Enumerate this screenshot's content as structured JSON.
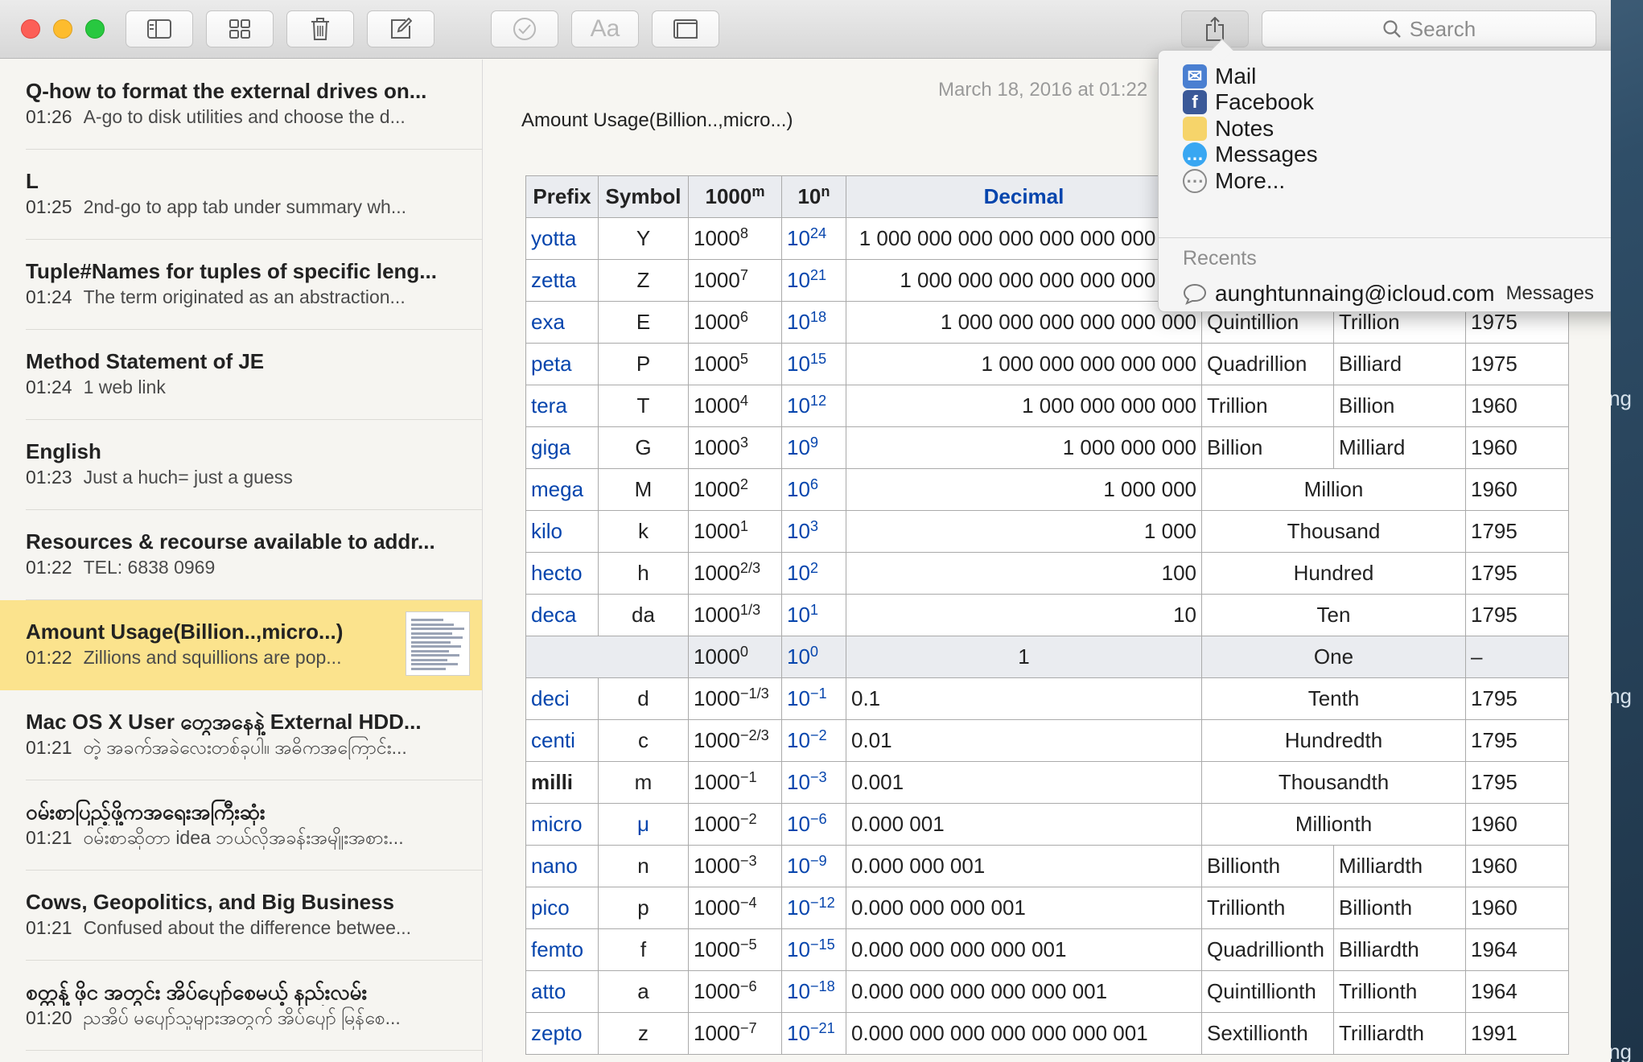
{
  "toolbar": {
    "buttons": [
      "sidebar-toggle",
      "gallery-view",
      "delete",
      "new-note",
      "checklist",
      "format",
      "table"
    ],
    "format_label": "Aa",
    "search_placeholder": "Search"
  },
  "notes": [
    {
      "title": "Q-how to format the external drives on...",
      "time": "01:26",
      "preview": "A-go to disk utilities and choose the d..."
    },
    {
      "title": "L",
      "time": "01:25",
      "preview": "2nd-go to app tab under summary wh..."
    },
    {
      "title": "Tuple#Names for tuples of specific leng...",
      "time": "01:24",
      "preview": "The term originated as an abstraction..."
    },
    {
      "title": "Method Statement of JE",
      "time": "01:24",
      "preview": "1 web link"
    },
    {
      "title": "English",
      "time": "01:23",
      "preview": "Just a huch= just a guess"
    },
    {
      "title": "Resources & recourse available to addr...",
      "time": "01:22",
      "preview": "TEL: 6838 0969"
    },
    {
      "title": "Amount Usage(Billion..,micro...)",
      "time": "01:22",
      "preview": "Zillions and squillions are pop...",
      "selected": true
    },
    {
      "title": "Mac OS X User တွေအနေနဲ့ External HDD...",
      "time": "01:21",
      "preview": "တဲ့ အခက်အခဲလေးတစ်ခုပါ။ အဓိကအကြောင်း..."
    },
    {
      "title": "ဝမ်းစာပြည့်ဖို့ကအရေးအကြီးဆုံး",
      "time": "01:21",
      "preview": "ဝမ်းစာဆိုတာ idea ဘယ်လိုအခန်းအမျိုးအစား..."
    },
    {
      "title": "Cows, Geopolitics, and Big Business",
      "time": "01:21",
      "preview": "Confused about the difference betwee..."
    },
    {
      "title": "စတ္တန့် ဖိုင အတွင်း အိပ်ပျော်စေမယ့် နည်းလမ်း",
      "time": "01:20",
      "preview": "ညအိပ် မပျော်သူများအတွက် အိပ်ပျော် မြန်စေ..."
    }
  ],
  "editor": {
    "date": "March 18, 2016 at 01:22",
    "heading": "Amount Usage(Billion..,micro...)"
  },
  "table": {
    "headers": {
      "prefix": "Prefix",
      "symbol": "Symbol",
      "k_base": "1000",
      "k_sup": "m",
      "t_base": "10",
      "t_sup": "n",
      "decimal": "Decimal"
    },
    "rows": [
      {
        "prefix": "yotta",
        "symbol": "Y",
        "kexp": "8",
        "texp": "24",
        "decimal": "1 000 000 000 000 000 000 000 000",
        "short": "",
        "long": "",
        "year": ""
      },
      {
        "prefix": "zetta",
        "symbol": "Z",
        "kexp": "7",
        "texp": "21",
        "decimal": "1 000 000 000 000 000 000 000",
        "short": "",
        "long": "",
        "year": ""
      },
      {
        "prefix": "exa",
        "symbol": "E",
        "kexp": "6",
        "texp": "18",
        "decimal": "1 000 000 000 000 000 000",
        "short": "Quintillion",
        "long": "Trillion",
        "year": "1975"
      },
      {
        "prefix": "peta",
        "symbol": "P",
        "kexp": "5",
        "texp": "15",
        "decimal": "1 000 000 000 000 000",
        "short": "Quadrillion",
        "long": "Billiard",
        "year": "1975"
      },
      {
        "prefix": "tera",
        "symbol": "T",
        "kexp": "4",
        "texp": "12",
        "decimal": "1 000 000 000 000",
        "short": "Trillion",
        "long": "Billion",
        "year": "1960"
      },
      {
        "prefix": "giga",
        "symbol": "G",
        "kexp": "3",
        "texp": "9",
        "decimal": "1 000 000 000",
        "short": "Billion",
        "long": "Milliard",
        "year": "1960"
      },
      {
        "prefix": "mega",
        "symbol": "M",
        "kexp": "2",
        "texp": "6",
        "decimal": "1 000 000",
        "merged": "Million",
        "year": "1960"
      },
      {
        "prefix": "kilo",
        "symbol": "k",
        "kexp": "1",
        "texp": "3",
        "decimal": "1 000",
        "merged": "Thousand",
        "year": "1795"
      },
      {
        "prefix": "hecto",
        "symbol": "h",
        "kexp": "2/3",
        "texp": "2",
        "decimal": "100",
        "merged": "Hundred",
        "year": "1795"
      },
      {
        "prefix": "deca",
        "symbol": "da",
        "kexp": "1/3",
        "texp": "1",
        "decimal": "10",
        "merged": "Ten",
        "year": "1795"
      },
      {
        "prefix": "",
        "symbol": "",
        "kexp": "0",
        "texp": "0",
        "decimal": "1",
        "merged": "One",
        "year": "–",
        "unit": true
      },
      {
        "prefix": "deci",
        "symbol": "d",
        "kexp": "−1/3",
        "texp": "−1",
        "decimal": "0.1",
        "merged": "Tenth",
        "year": "1795"
      },
      {
        "prefix": "centi",
        "symbol": "c",
        "kexp": "−2/3",
        "texp": "−2",
        "decimal": "0.01",
        "merged": "Hundredth",
        "year": "1795"
      },
      {
        "prefix": "milli",
        "symbol": "m",
        "kexp": "−1",
        "texp": "−3",
        "decimal": "0.001",
        "merged": "Thousandth",
        "year": "1795",
        "bold": true
      },
      {
        "prefix": "micro",
        "symbol": "μ",
        "kexp": "−2",
        "texp": "−6",
        "decimal": "0.000 001",
        "merged": "Millionth",
        "year": "1960"
      },
      {
        "prefix": "nano",
        "symbol": "n",
        "kexp": "−3",
        "texp": "−9",
        "decimal": "0.000 000 001",
        "short": "Billionth",
        "long": "Milliardth",
        "year": "1960"
      },
      {
        "prefix": "pico",
        "symbol": "p",
        "kexp": "−4",
        "texp": "−12",
        "decimal": "0.000 000 000 001",
        "short": "Trillionth",
        "long": "Billionth",
        "year": "1960"
      },
      {
        "prefix": "femto",
        "symbol": "f",
        "kexp": "−5",
        "texp": "−15",
        "decimal": "0.000 000 000 000 001",
        "short": "Quadrillionth",
        "long": "Billiardth",
        "year": "1964"
      },
      {
        "prefix": "atto",
        "symbol": "a",
        "kexp": "−6",
        "texp": "−18",
        "decimal": "0.000 000 000 000 000 001",
        "short": "Quintillionth",
        "long": "Trillionth",
        "year": "1964"
      },
      {
        "prefix": "zepto",
        "symbol": "z",
        "kexp": "−7",
        "texp": "−21",
        "decimal": "0.000 000 000 000 000 000 001",
        "short": "Sextillionth",
        "long": "Trilliardth",
        "year": "1991"
      }
    ]
  },
  "share_menu": {
    "items": [
      {
        "label": "Mail",
        "icon": "mail-icon",
        "color": "#4a7fd1"
      },
      {
        "label": "Facebook",
        "icon": "facebook-icon",
        "color": "#3b5998"
      },
      {
        "label": "Notes",
        "icon": "notes-icon",
        "color": "#f6d46a"
      },
      {
        "label": "Messages",
        "icon": "messages-icon",
        "color": "#39a7f2"
      },
      {
        "label": "More...",
        "icon": "more-icon",
        "color": "#8a8a8a"
      }
    ],
    "recents_label": "Recents",
    "recent": {
      "address": "aunghtunnaing@icloud.com",
      "service": "Messages"
    }
  },
  "desktop_fragments": [
    "ng",
    "ng",
    "ng"
  ],
  "colors": {
    "selected_note": "#fbe38d",
    "link": "#0645ad",
    "table_header": "#eaecf0"
  }
}
